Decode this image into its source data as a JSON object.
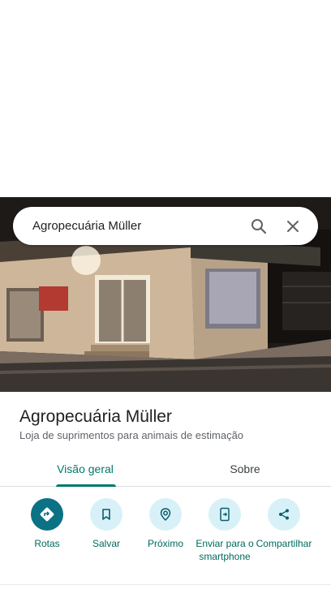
{
  "search": {
    "query": "Agropecuária Müller"
  },
  "place": {
    "name": "Agropecuária Müller",
    "category": "Loja de suprimentos para animais de estimação"
  },
  "tabs": [
    {
      "label": "Visão geral",
      "selected": true
    },
    {
      "label": "Sobre",
      "selected": false
    }
  ],
  "actions": [
    {
      "label": "Rotas",
      "icon": "directions-icon"
    },
    {
      "label": "Salvar",
      "icon": "bookmark-icon"
    },
    {
      "label": "Próximo",
      "icon": "nearby-icon"
    },
    {
      "label": "Enviar para o smartphone",
      "icon": "send-to-phone-icon"
    },
    {
      "label": "Compartilhar",
      "icon": "share-icon"
    }
  ],
  "colors": {
    "accent": "#00796b",
    "primary_action": "#0b7285",
    "action_bg": "#d8f1f8"
  }
}
